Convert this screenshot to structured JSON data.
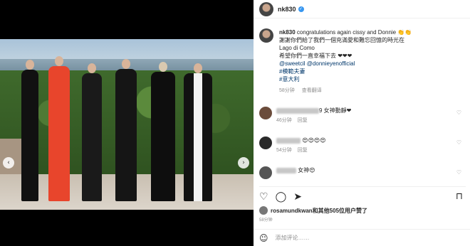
{
  "post": {
    "username": "nk830",
    "caption_user": "nk830",
    "caption_line1": "congratulations again cissy and Donnie 👏👏",
    "caption_line2": "謝謝你們給了我們一個充滿愛和難忘回憶的時光在",
    "caption_line3": "Lago di Como",
    "caption_line4": "希望你們一直幸福下去 ❤❤❤",
    "mentions": "@sweetcil @donnieyenofficial",
    "tag1": "#模範夫妻",
    "tag2": "#意大利",
    "caption_time": "58分钟",
    "caption_reply": "查看翻译"
  },
  "comments": [
    {
      "text": "9 女神動靜❤",
      "time": "46分钟",
      "action": "回复"
    },
    {
      "text": "😍😍😍😍",
      "time": "54分钟",
      "action": "回复"
    },
    {
      "text": "女神😍",
      "time": "",
      "action": ""
    }
  ],
  "likes_text_user": "rosamundkwan",
  "likes_text_rest": "和其他505位用户赞了",
  "post_time": "58分钟",
  "add_comment_placeholder": "添加评论……",
  "icons": [
    "verified-badge",
    "heart-icon",
    "comment-icon",
    "share-icon",
    "bookmark-icon",
    "emoji-icon"
  ]
}
